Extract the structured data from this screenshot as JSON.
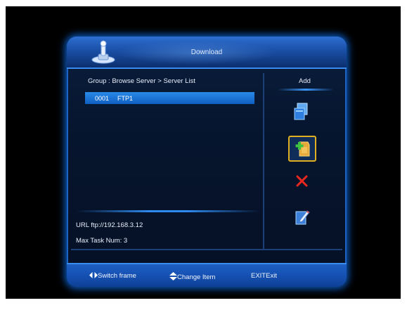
{
  "window": {
    "title": "Download"
  },
  "breadcrumb": "Group : Browse Server > Server List",
  "server_list": [
    {
      "index": "0001",
      "name": "FTP1",
      "selected": true
    }
  ],
  "details": {
    "url": "URL ftp://192.168.3.12",
    "max_task": "Max Task Num: 3"
  },
  "actions": {
    "title": "Add",
    "items": [
      {
        "icon": "copy-icon",
        "selected": false
      },
      {
        "icon": "add-icon",
        "selected": true
      },
      {
        "icon": "delete-icon",
        "selected": false
      },
      {
        "icon": "edit-icon",
        "selected": false
      }
    ]
  },
  "footer": {
    "switch_frame": "Switch frame",
    "change_item": "Change Item",
    "exit_key": "EXIT",
    "exit_label": "Exit"
  },
  "colors": {
    "accent": "#2a8ae8",
    "selection_border": "#e0b020",
    "delete": "#e8281e"
  }
}
